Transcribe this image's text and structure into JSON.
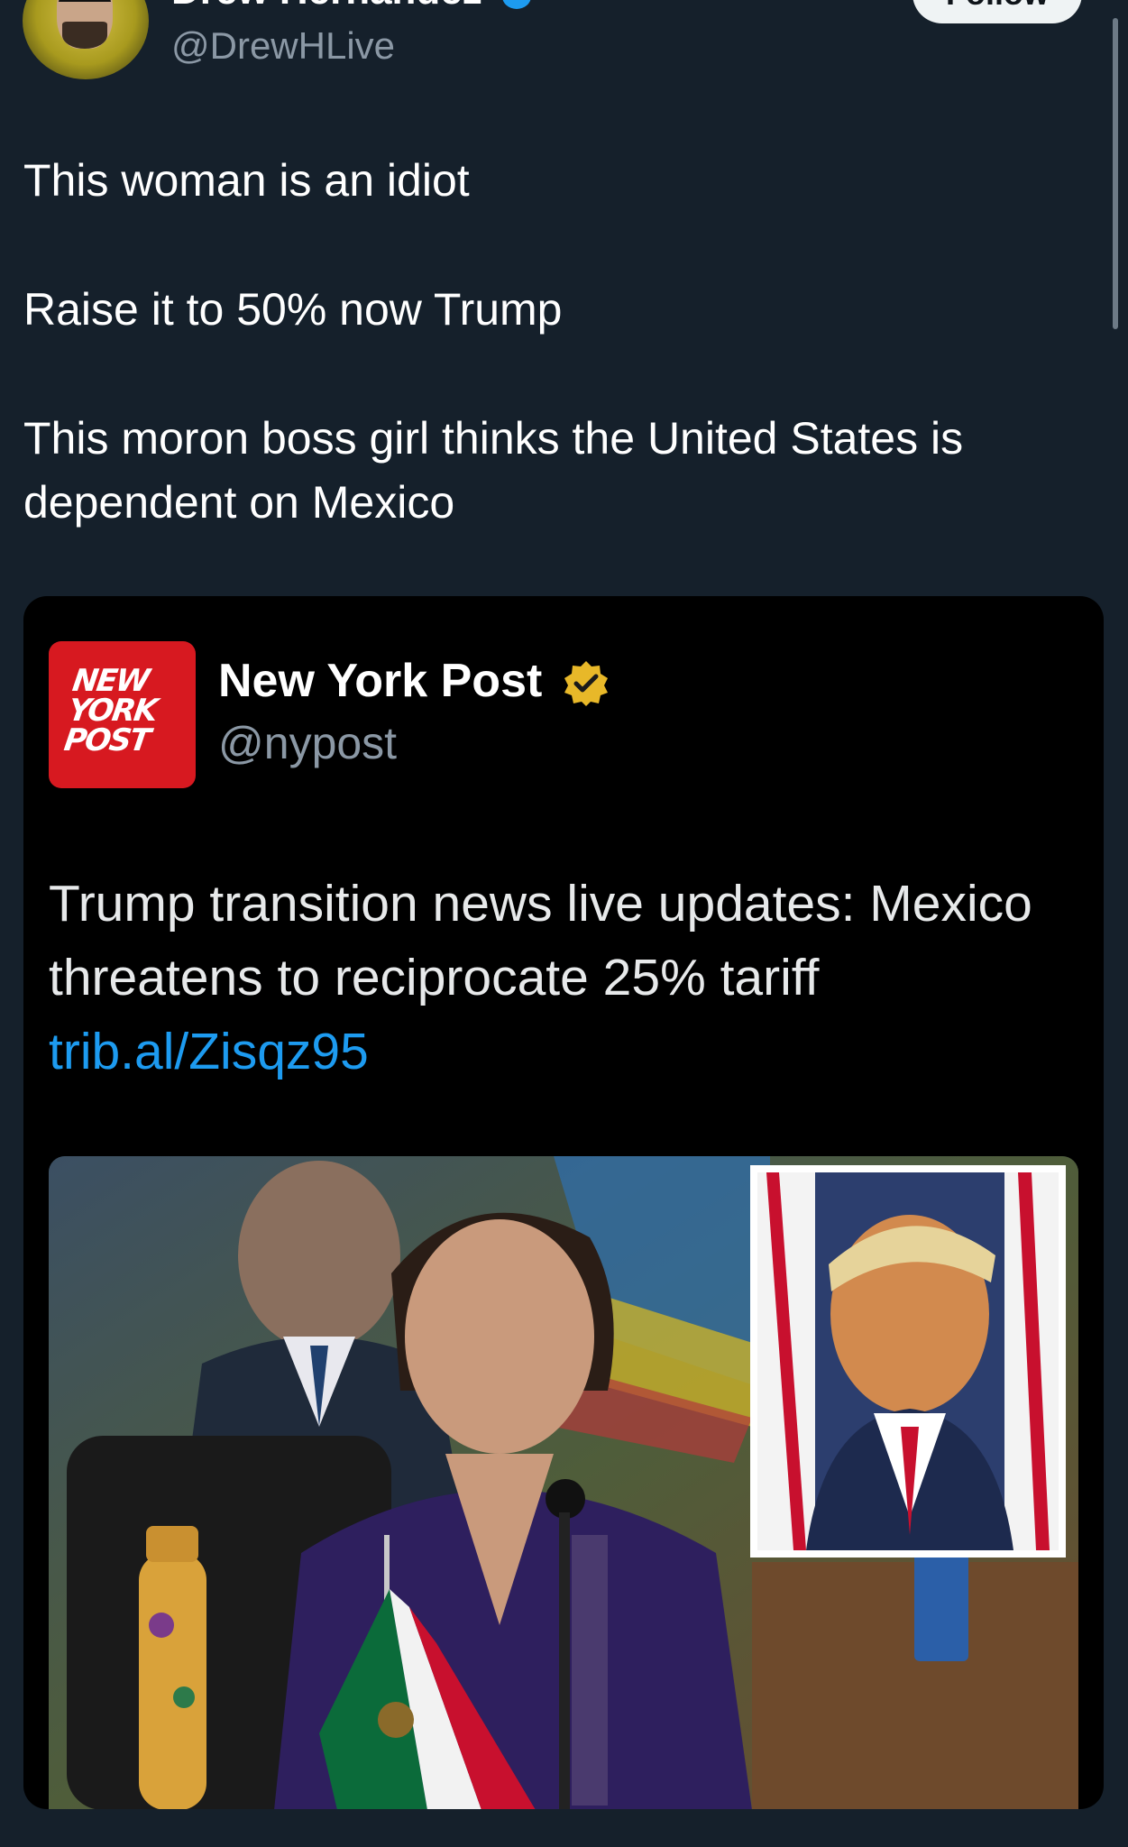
{
  "author": {
    "display_name": "Drew Hernandez",
    "handle": "@DrewHLive",
    "follow_label": "Follow"
  },
  "tweet": {
    "lines": [
      "This woman is an idiot",
      "Raise it to 50% now Trump",
      "This moron boss girl thinks the United States is dependent on Mexico"
    ]
  },
  "quoted": {
    "logo_text": [
      "NEW",
      "YORK",
      "POST"
    ],
    "display_name": "New York Post",
    "handle": "@nypost",
    "text": "Trump transition news live updates: Mexico threatens to reciprocate 25% tariff ",
    "link": "trib.al/Zisqz95"
  },
  "colors": {
    "background": "#15202b",
    "card": "#000000",
    "link": "#1d9bf0",
    "verified_blue": "#1d9bf0",
    "verified_gold": "#e8b829",
    "nyp_red": "#d71920"
  },
  "icons": {
    "author_badge": "verified-badge-icon",
    "quoted_badge": "gold-verified-badge-icon"
  }
}
